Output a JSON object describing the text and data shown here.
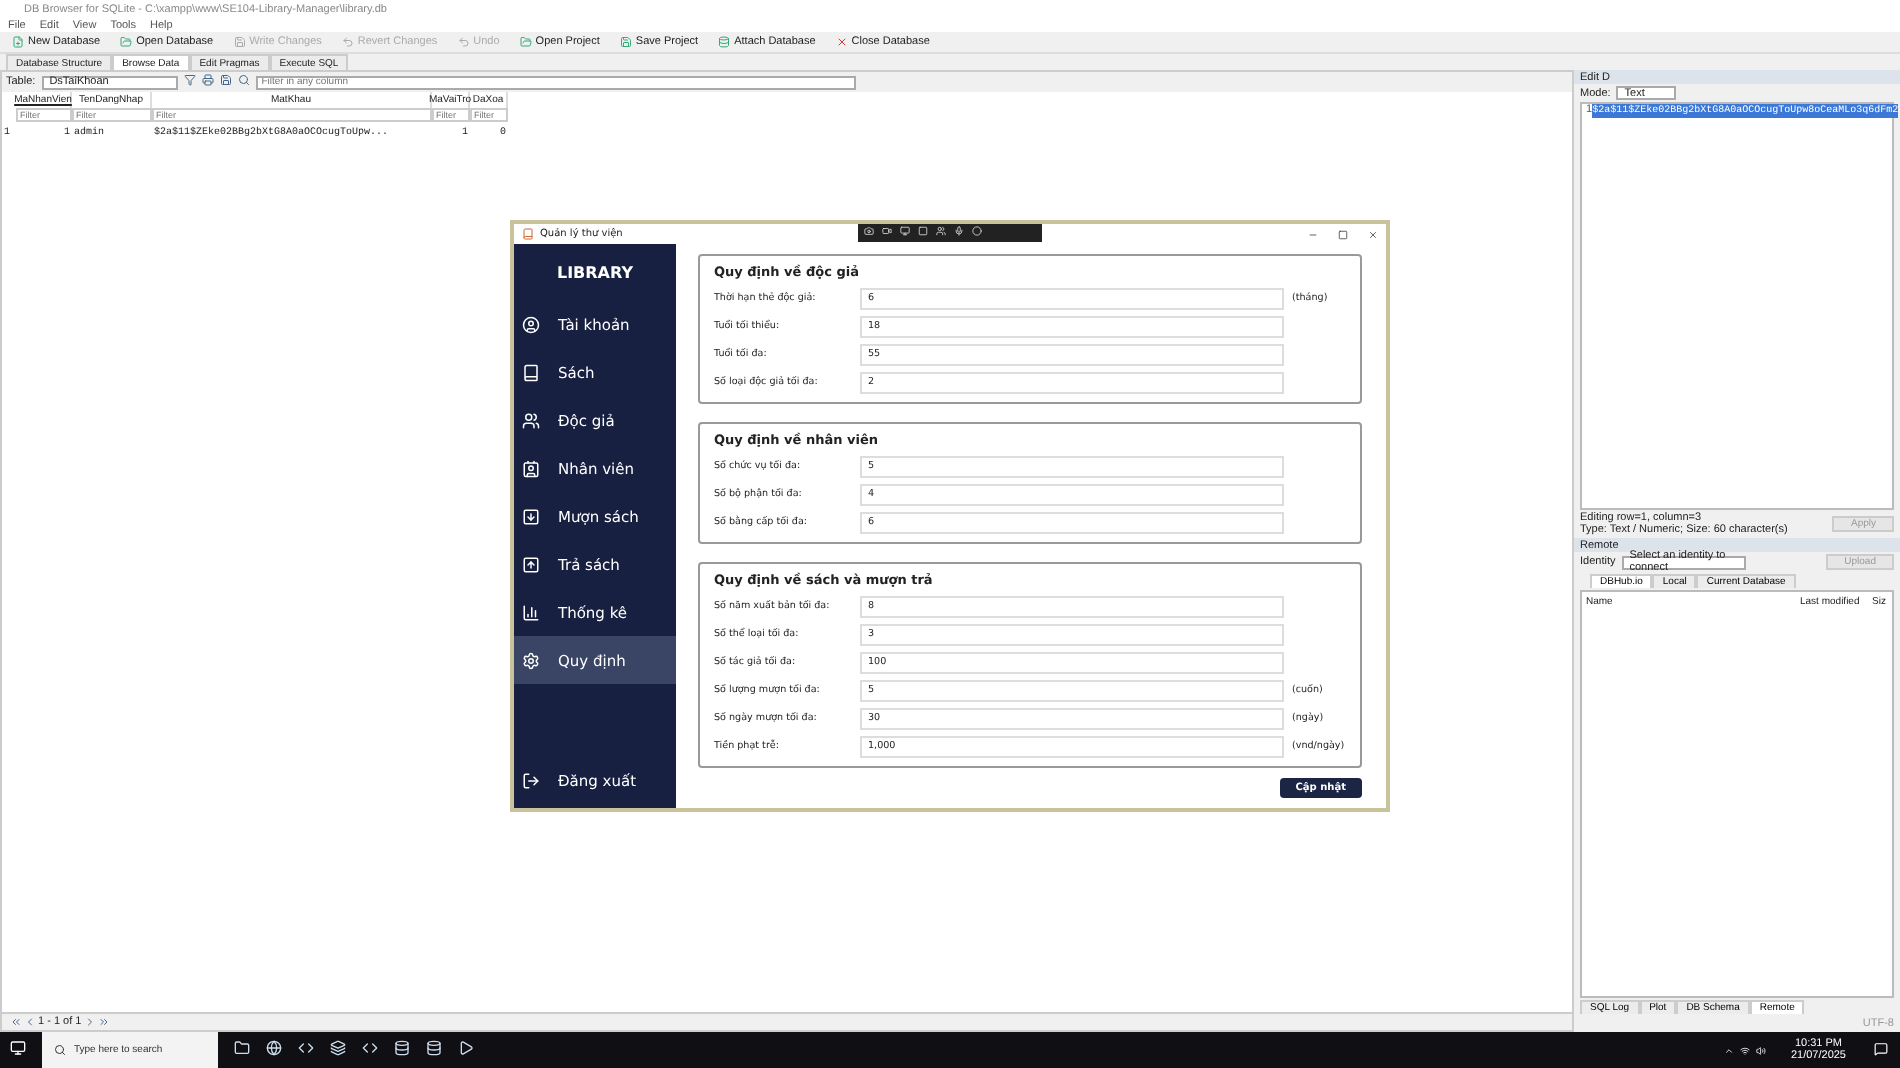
{
  "window": {
    "title": "DB Browser for SQLite - C:\\xampp\\www\\SE104-Library-Manager\\library.db"
  },
  "menu": [
    "File",
    "Edit",
    "View",
    "Tools",
    "Help"
  ],
  "toolbar": [
    {
      "label": "New Database",
      "disabled": false
    },
    {
      "label": "Open Database",
      "disabled": false
    },
    {
      "label": "Write Changes",
      "disabled": true
    },
    {
      "label": "Revert Changes",
      "disabled": true
    },
    {
      "label": "Undo",
      "disabled": true
    },
    {
      "label": "Open Project",
      "disabled": false
    },
    {
      "label": "Save Project",
      "disabled": false
    },
    {
      "label": "Attach Database",
      "disabled": false
    },
    {
      "label": "Close Database",
      "disabled": false
    }
  ],
  "tabs": [
    {
      "label": "Database Structure",
      "selected": false
    },
    {
      "label": "Browse Data",
      "selected": true
    },
    {
      "label": "Edit Pragmas",
      "selected": false
    },
    {
      "label": "Execute SQL",
      "selected": false
    }
  ],
  "browse": {
    "table_label": "Table:",
    "table": "DsTaiKhoan",
    "filter_placeholder": "Filter in any column",
    "columns": [
      {
        "label": "MaNhanVien",
        "filter_placeholder": "Filter"
      },
      {
        "label": "TenDangNhap",
        "filter_placeholder": "Filter"
      },
      {
        "label": "MatKhau",
        "filter_placeholder": "Filter"
      },
      {
        "label": "MaVaiTro",
        "filter_placeholder": "Filter"
      },
      {
        "label": "DaXoa",
        "filter_placeholder": "Filter"
      }
    ],
    "rows": [
      {
        "number": "1",
        "cells": [
          "1",
          "admin",
          "$2a$11$ZEke02BBg2bXtG8A0aOCOcugToUpw...",
          "1",
          "0"
        ]
      }
    ],
    "pager": "1 - 1 of 1"
  },
  "edit_cell": {
    "title": "Edit D",
    "mode_label": "Mode:",
    "mode": "Text",
    "line_number": "1",
    "value": "$2a$11$ZEke02BBg2bXtG8A0aOCOcugToUpw8oCeaMLo3q6dFm2",
    "status": [
      "Editing row=1, column=3",
      "Type: Text / Numeric; Size: 60 character(s)"
    ],
    "apply": "Apply"
  },
  "remote": {
    "title": "Remote",
    "identity_label": "Identity",
    "identity": "Select an identity to connect",
    "upload": "Upload",
    "tabs": [
      {
        "label": "DBHub.io",
        "selected": true
      },
      {
        "label": "Local",
        "selected": false
      },
      {
        "label": "Current Database",
        "selected": false
      }
    ],
    "columns": [
      "Name",
      "Last modified",
      "Siz"
    ]
  },
  "dock_tabs": [
    {
      "label": "SQL Log",
      "selected": false
    },
    {
      "label": "Plot",
      "selected": false
    },
    {
      "label": "DB Schema",
      "selected": false
    },
    {
      "label": "Remote",
      "selected": true
    }
  ],
  "encoding": "UTF-8",
  "dialog": {
    "title": "Quản lý thư viện",
    "brand": "LIBRARY",
    "nav": [
      {
        "label": "Tài khoản",
        "selected": false
      },
      {
        "label": "Sách",
        "selected": false
      },
      {
        "label": "Độc giả",
        "selected": false
      },
      {
        "label": "Nhân viên",
        "selected": false
      },
      {
        "label": "Mượn sách",
        "selected": false
      },
      {
        "label": "Trả sách",
        "selected": false
      },
      {
        "label": "Thống kê",
        "selected": false
      },
      {
        "label": "Quy định",
        "selected": true
      }
    ],
    "logout": "Đăng xuất",
    "sections": [
      {
        "title": "Quy định về độc giả",
        "fields": [
          {
            "label": "Thời hạn thẻ độc giả:",
            "value": "6",
            "unit": "(tháng)"
          },
          {
            "label": "Tuổi tối thiểu:",
            "value": "18"
          },
          {
            "label": "Tuổi tối đa:",
            "value": "55"
          },
          {
            "label": "Số loại độc giả tối đa:",
            "value": "2"
          }
        ]
      },
      {
        "title": "Quy định về nhân viên",
        "fields": [
          {
            "label": "Số chức vụ tối đa:",
            "value": "5"
          },
          {
            "label": "Số bộ phận tối đa:",
            "value": "4"
          },
          {
            "label": "Số bằng cấp tối đa:",
            "value": "6"
          }
        ]
      },
      {
        "title": "Quy định về sách và mượn trả",
        "fields": [
          {
            "label": "Số năm xuất bản tối đa:",
            "value": "8"
          },
          {
            "label": "Số thể loại tối đa:",
            "value": "3"
          },
          {
            "label": "Số tác giả tối đa:",
            "value": "100"
          },
          {
            "label": "Số lượng mượn tối đa:",
            "value": "5",
            "unit": "(cuốn)"
          },
          {
            "label": "Số ngày mượn tối đa:",
            "value": "30",
            "unit": "(ngày)"
          },
          {
            "label": "Tiền phạt trễ:",
            "value": "1,000",
            "unit": "(vnd/ngày)"
          }
        ]
      }
    ],
    "submit": "Cập nhật"
  },
  "taskbar": {
    "search_placeholder": "Type here to search",
    "time": "10:31 PM",
    "date": "21/07/2025"
  }
}
